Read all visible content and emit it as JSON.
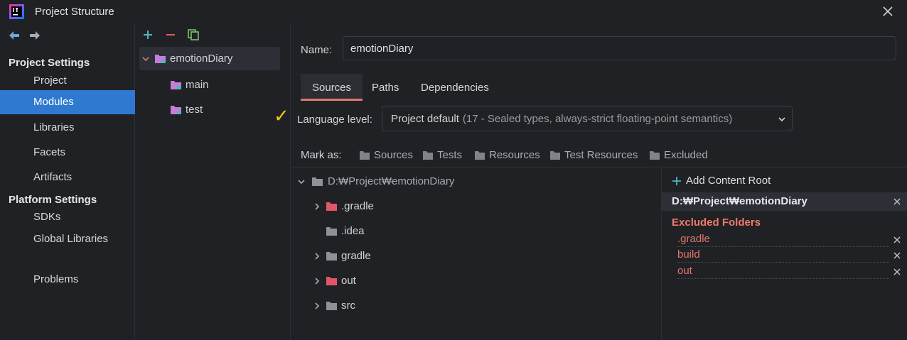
{
  "window": {
    "title": "Project Structure"
  },
  "sidebar": {
    "project_settings_header": "Project Settings",
    "project_items": [
      {
        "label": "Project"
      },
      {
        "label": "Modules",
        "selected": true
      },
      {
        "label": "Libraries"
      },
      {
        "label": "Facets"
      },
      {
        "label": "Artifacts"
      }
    ],
    "platform_settings_header": "Platform Settings",
    "platform_items": [
      {
        "label": "SDKs"
      },
      {
        "label": "Global Libraries"
      }
    ],
    "problems_label": "Problems"
  },
  "modules": {
    "root": "emotionDiary",
    "children": [
      "main",
      "test"
    ]
  },
  "form": {
    "name_label": "Name:",
    "name_value": "emotionDiary"
  },
  "tabs": [
    "Sources",
    "Paths",
    "Dependencies"
  ],
  "active_tab": "Sources",
  "language": {
    "label": "Language level:",
    "value_main": "Project default",
    "value_detail": "(17 - Sealed types, always-strict floating-point semantics)"
  },
  "mark_as": {
    "label": "Mark as:",
    "buttons": [
      "Sources",
      "Tests",
      "Resources",
      "Test Resources",
      "Excluded"
    ]
  },
  "tree": {
    "root": "D:₩Project₩emotionDiary",
    "children": [
      ".gradle",
      ".idea",
      "gradle",
      "out",
      "src"
    ]
  },
  "content_root": {
    "add_label": "Add Content Root",
    "path": "D:₩Project₩emotionDiary",
    "excluded_title": "Excluded Folders",
    "excluded": [
      ".gradle",
      "build",
      "out"
    ]
  },
  "colors": {
    "accent": "#2f7ad0",
    "excluded": "#e0776c",
    "check": "#f3c316",
    "module_folder": "#c77dd8"
  },
  "icons": {
    "app": "intellij-logo-icon",
    "close": "close-icon",
    "back": "arrow-left-icon",
    "forward": "arrow-right-icon",
    "add": "plus-icon",
    "remove": "minus-icon",
    "copy": "copy-icon"
  }
}
